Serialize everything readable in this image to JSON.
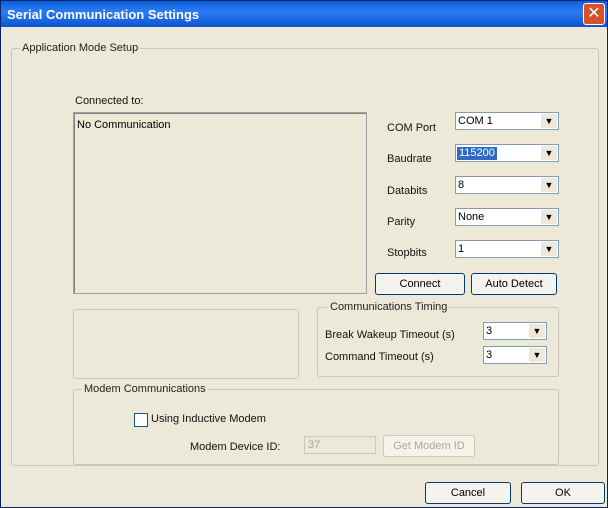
{
  "window": {
    "title": "Serial Communication Settings"
  },
  "app_mode": {
    "group_label": "Application Mode Setup",
    "connected_label": "Connected to:",
    "connected_value": "No Communication"
  },
  "serial": {
    "com_port": {
      "label": "COM Port",
      "value": "COM 1"
    },
    "baudrate": {
      "label": "Baudrate",
      "value": "115200"
    },
    "databits": {
      "label": "Databits",
      "value": "8"
    },
    "parity": {
      "label": "Parity",
      "value": "None"
    },
    "stopbits": {
      "label": "Stopbits",
      "value": "1"
    },
    "connect_label": "Connect",
    "auto_detect_label": "Auto Detect"
  },
  "timing": {
    "group_label": "Communications Timing",
    "break_wakeup": {
      "label": "Break Wakeup Timeout (s)",
      "value": "3"
    },
    "command_timeout": {
      "label": "Command Timeout (s)",
      "value": "3"
    }
  },
  "modem": {
    "group_label": "Modem Communications",
    "inductive_label": "Using Inductive Modem",
    "device_id_label": "Modem Device ID:",
    "device_id_value": "37",
    "get_id_label": "Get Modem ID"
  },
  "footer": {
    "cancel_label": "Cancel",
    "ok_label": "OK"
  }
}
